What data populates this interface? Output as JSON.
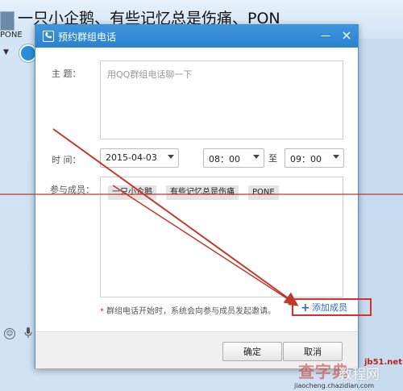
{
  "background": {
    "chat_title": "一只小企鹅、有些记忆总是伤痛、PON",
    "chat_subtitle": "PONE",
    "toolbar_smile": "☺",
    "toolbar_mic": "🎤",
    "dropdown_arrow": "▼"
  },
  "dialog": {
    "title": "预约群组电话",
    "topic_label": "主  题：",
    "topic_placeholder": "用QQ群组电话聊一下",
    "time_label": "时  间：",
    "date_value": "2015-04-03",
    "start_time": "08：00",
    "to_label": "至",
    "end_time": "09：00",
    "members_label": "参与成员：",
    "members": [
      "一只小企鹅",
      "有些记忆总是伤痛",
      "PONE"
    ],
    "notice_star": "*",
    "notice_text": "群组电话开始时，系统会向参与成员发起邀请。",
    "add_member_icon": "+",
    "add_member_label": "添加成员",
    "ok_label": "确定",
    "cancel_label": "取消",
    "minimize_glyph": "—",
    "close_glyph": "×"
  },
  "watermark": {
    "logo_text": "查字典",
    "logo_text_2": "教程网",
    "brand": "jb51.net",
    "url": "jiaocheng.chazidian.com"
  },
  "colors": {
    "titlebar": "#2a82cf",
    "annotation_red": "#d43030",
    "link_blue": "#1e72c4"
  }
}
